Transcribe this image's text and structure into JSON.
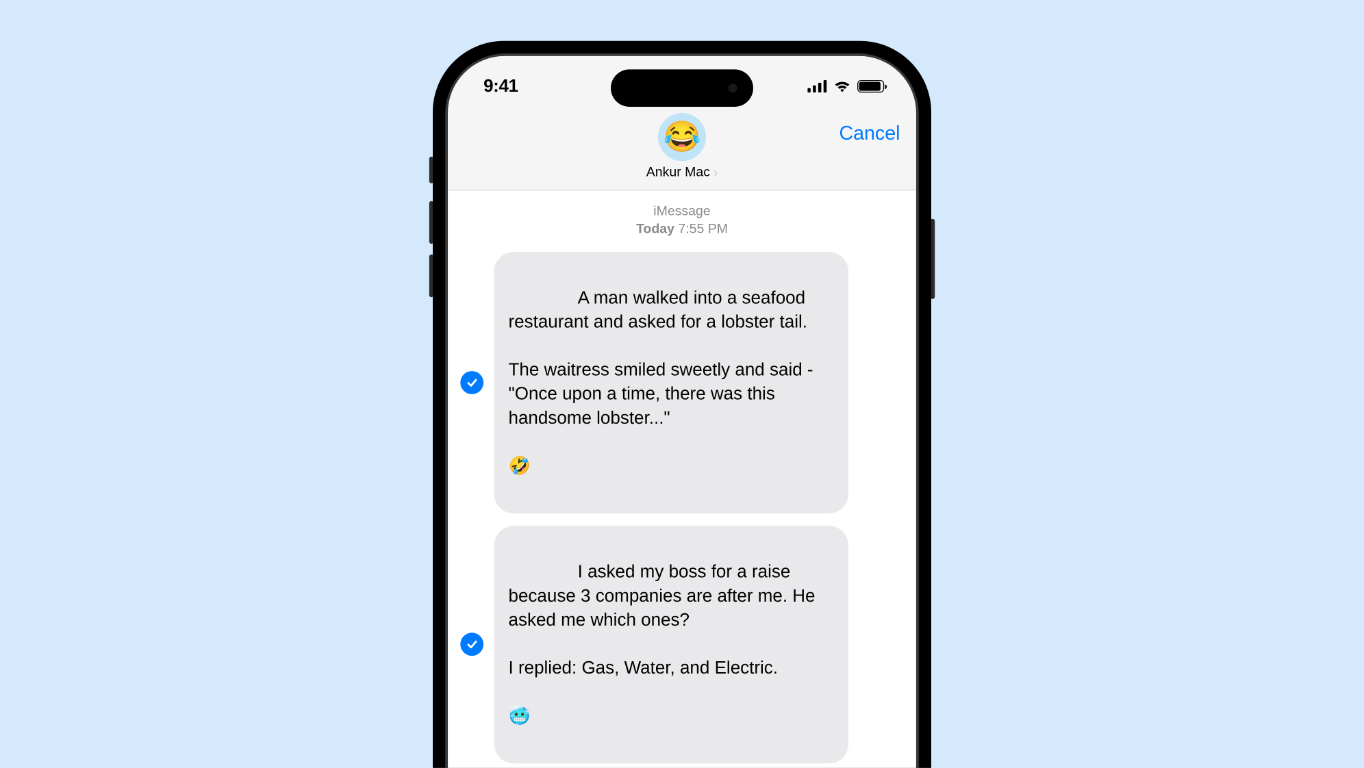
{
  "status": {
    "time": "9:41"
  },
  "header": {
    "avatar_emoji": "😂",
    "contact_name": "Ankur Mac",
    "cancel_label": "Cancel"
  },
  "thread": {
    "service_label": "iMessage",
    "date_prefix": "Today",
    "time": "7:55 PM",
    "messages": [
      {
        "selected": true,
        "text": "A man walked into a seafood restaurant and asked for a lobster tail.\n\nThe waitress smiled sweetly and said - \"Once upon a time, there was this handsome lobster...\"\n\n🤣"
      },
      {
        "selected": true,
        "text": "I asked my boss for a raise because 3 companies are after me. He asked me which ones?\n\nI replied: Gas, Water, and Electric.\n\n🥶"
      }
    ]
  }
}
